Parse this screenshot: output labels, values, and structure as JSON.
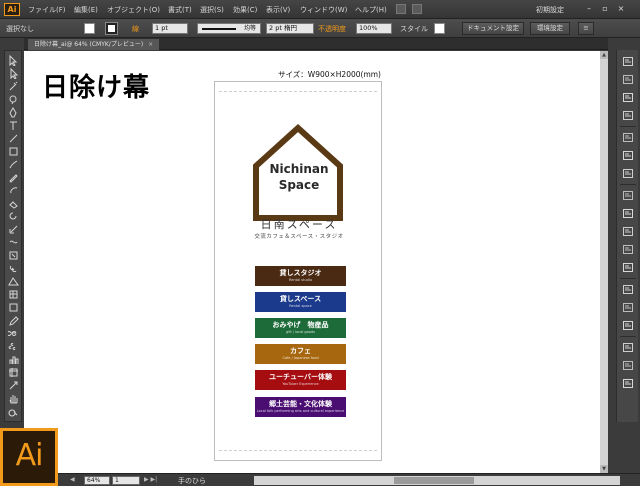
{
  "app": {
    "logo_small": "Ai",
    "logo_big": "Ai",
    "accent": "#f29a1b"
  },
  "menu": [
    {
      "label": "ファイル(F)"
    },
    {
      "label": "編集(E)"
    },
    {
      "label": "オブジェクト(O)"
    },
    {
      "label": "書式(T)"
    },
    {
      "label": "選択(S)"
    },
    {
      "label": "効果(C)"
    },
    {
      "label": "表示(V)"
    },
    {
      "label": "ウィンドウ(W)"
    },
    {
      "label": "ヘルプ(H)"
    }
  ],
  "workspace": {
    "label": "初期設定"
  },
  "control_bar": {
    "selection": "選択なし",
    "stroke_label": "線",
    "stroke_weight": "1 pt",
    "stroke_profile": "均等",
    "brush": "2 pt 楕円",
    "opacity_label": "不透明度",
    "opacity_value": "100%",
    "style_label": "スタイル",
    "doc_setup_button": "ドキュメント設定",
    "prefs_button": "環境設定"
  },
  "document_tab": {
    "title": "日除け幕_ai@ 64% (CMYK/プレビュー)",
    "close": "×"
  },
  "canvas": {
    "big_title": "日除け幕",
    "size_label": "サイズ：W900×H2000(mm)",
    "logo": {
      "line1": "Nichinan",
      "line2": "Space",
      "house_color": "#5a3a15"
    },
    "jp_name": "日南スペース",
    "jp_sub": "交流カフェ＆スペース・スタジオ",
    "bars": [
      {
        "jp": "貸しスタジオ",
        "en": "Rental studio",
        "color": "#4a2a12"
      },
      {
        "jp": "貸しスペース",
        "en": "Rental space",
        "color": "#1b3a8c"
      },
      {
        "jp": "おみやげ　物産品",
        "en": "gift / local goods",
        "color": "#1e6b3a"
      },
      {
        "jp": "カフェ",
        "en": "Cafe / Japanese food",
        "color": "#a7670f"
      },
      {
        "jp": "ユーチューバー体験",
        "en": "YouTuber Experience",
        "color": "#a50d10"
      },
      {
        "jp": "郷土芸能・文化体験",
        "en": "Local folk performing arts and cultural experience",
        "color": "#4a0d72"
      }
    ]
  },
  "status_bar": {
    "zoom": "64%",
    "page": "1",
    "tool_status": "手のひら"
  },
  "tools": [
    "selection-tool",
    "direct-selection-tool",
    "magic-wand-tool",
    "lasso-tool",
    "pen-tool",
    "type-tool",
    "line-tool",
    "rectangle-tool",
    "paintbrush-tool",
    "pencil-tool",
    "blob-brush-tool",
    "eraser-tool",
    "rotate-tool",
    "scale-tool",
    "width-tool",
    "free-transform-tool",
    "shape-builder-tool",
    "perspective-grid-tool",
    "mesh-tool",
    "gradient-tool",
    "eyedropper-tool",
    "blend-tool",
    "symbol-sprayer-tool",
    "column-graph-tool",
    "artboard-tool",
    "slice-tool",
    "hand-tool",
    "zoom-tool"
  ],
  "dock": [
    "color-panel-icon",
    "color-guide-icon",
    "swatches-icon",
    "brushes-icon",
    "symbols-icon",
    "graphic-styles-icon",
    "appearance-icon",
    "layers-icon",
    "stroke-icon",
    "gradient-icon",
    "transparency-icon",
    "align-icon",
    "transform-icon",
    "character-icon",
    "paragraph-icon",
    "opentype-icon",
    "links-icon",
    "artboards-icon"
  ]
}
